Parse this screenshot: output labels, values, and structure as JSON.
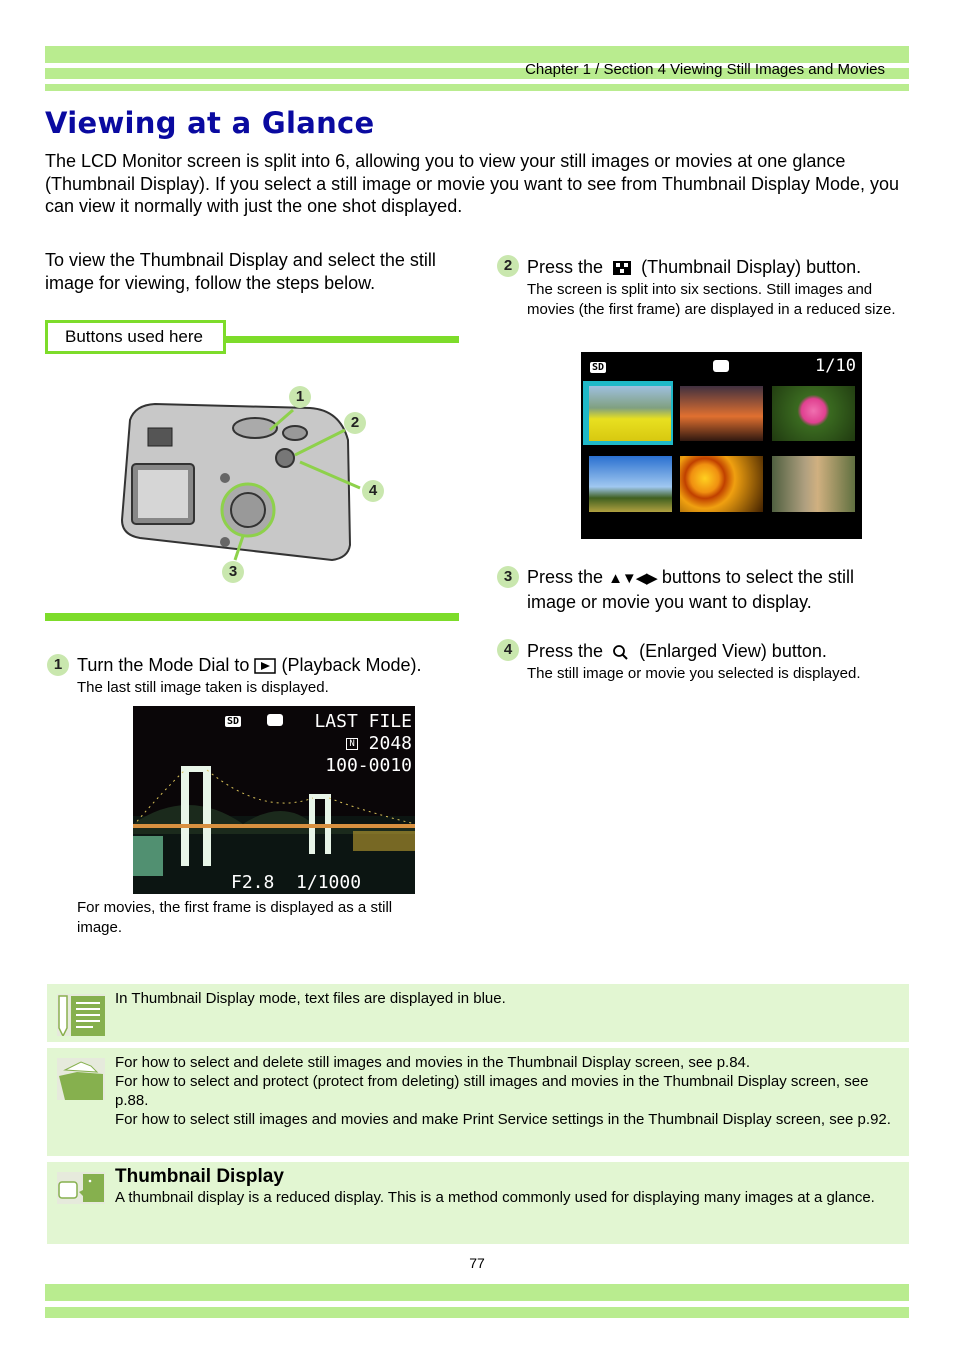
{
  "header": {
    "breadcrumb": "Chapter 1 / Section 4  Viewing Still Images and Movies"
  },
  "title": "Viewing at a Glance",
  "intro": "The LCD Monitor screen is split into 6, allowing you to view your still images or movies at one glance (Thumbnail Display). If you select a still image or movie you want to see from Thumbnail Display Mode, you can view it normally with just the one shot displayed.",
  "left": {
    "lead": "To view the Thumbnail Display and select the still image for viewing, follow the steps below.",
    "buttons_used_label": "Buttons used here",
    "callouts": [
      "1",
      "2",
      "3",
      "4"
    ]
  },
  "steps": [
    {
      "num": "1",
      "pre": "Turn the Mode Dial to",
      "post": "(Playback Mode).",
      "icon": "playback-icon",
      "desc": "The last still image taken is displayed."
    },
    {
      "num": "2",
      "pre": "Press the",
      "post": "(Thumbnail Display) button.",
      "icon": "thumbnail-icon",
      "desc": "The screen is split into six sections. Still images and movies (the first frame) are displayed in a reduced size."
    },
    {
      "num": "3",
      "pre": "Press the",
      "post": "buttons to select the still image or movie you want to display.",
      "icon": "arrow-keys-icon",
      "symbols": "▲▼◀▶"
    },
    {
      "num": "4",
      "pre": "Press the",
      "post": "(Enlarged View) button.",
      "icon": "magnifier-icon",
      "desc": "The still image or movie you selected is displayed."
    }
  ],
  "lcd_playback": {
    "card": "SD",
    "last_file": "LAST FILE",
    "quality": "N",
    "size": "2048",
    "file_no": "100-0010",
    "exposure": "F2.8  1/1000",
    "caption": "For movies, the first frame is displayed as a still image."
  },
  "lcd_thumb": {
    "card": "SD",
    "counter": "1/10"
  },
  "notes": [
    {
      "icon": "memo-icon",
      "lines": [
        "In Thumbnail Display mode, text files are displayed in blue."
      ]
    },
    {
      "icon": "folder-icon",
      "lines": [
        "For how to select and delete still images and movies in the Thumbnail Display screen, see p.84.",
        "For how to select and protect (protect from deleting) still images and movies in the Thumbnail Display screen, see p.88.",
        "For how to select still images and movies and make Print Service settings in the Thumbnail Display screen, see p.92."
      ]
    },
    {
      "icon": "glossary-icon",
      "title": "Thumbnail Display",
      "lines": [
        "A thumbnail display is a reduced display. This is a method commonly used for displaying many images at a glance."
      ]
    }
  ],
  "page_number": "77",
  "colors": {
    "accent_green": "#b9ec8f",
    "bright_green": "#7ddc2a",
    "title_blue": "#0a0aa0",
    "note_bg": "#e2f6d2",
    "selection": "#1fb8c8"
  }
}
